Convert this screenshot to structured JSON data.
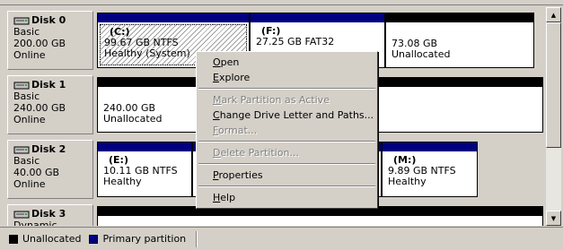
{
  "disks": [
    {
      "name": "Disk 0",
      "type": "Basic",
      "size": "200.00 GB",
      "status": "Online",
      "volumes": [
        {
          "letter": "(C:)",
          "size_fs": "99.67 GB NTFS",
          "status": "Healthy (System)",
          "kind": "primary",
          "selected": true
        },
        {
          "letter": "(F:)",
          "size_fs": "27.25 GB FAT32",
          "status": "",
          "kind": "primary",
          "selected": false
        },
        {
          "letter": "",
          "size_fs": "73.08 GB",
          "status": "Unallocated",
          "kind": "unallocated",
          "selected": false
        }
      ]
    },
    {
      "name": "Disk 1",
      "type": "Basic",
      "size": "240.00 GB",
      "status": "Online",
      "volumes": [
        {
          "letter": "",
          "size_fs": "240.00 GB",
          "status": "Unallocated",
          "kind": "unallocated",
          "selected": false
        }
      ]
    },
    {
      "name": "Disk 2",
      "type": "Basic",
      "size": "40.00 GB",
      "status": "Online",
      "volumes": [
        {
          "letter": "(E:)",
          "size_fs": "10.11 GB NTFS",
          "status": "Healthy",
          "kind": "primary",
          "selected": false
        },
        {
          "letter": "",
          "size_fs": "",
          "status": "",
          "kind": "primary",
          "selected": false
        },
        {
          "letter": "(M:)",
          "size_fs": "9.89 GB NTFS",
          "status": "Healthy",
          "kind": "primary",
          "selected": false
        }
      ]
    },
    {
      "name": "Disk 3",
      "type": "Dynamic",
      "size": "",
      "status": "",
      "volumes": [
        {
          "letter": "",
          "size_fs": "",
          "status": "",
          "kind": "unallocated",
          "selected": false
        }
      ]
    }
  ],
  "legend": [
    {
      "label": "Unallocated",
      "color": "#000000"
    },
    {
      "label": "Primary partition",
      "color": "#000080"
    }
  ],
  "context_menu": {
    "items": [
      {
        "label": "Open",
        "access": "O",
        "enabled": true
      },
      {
        "label": "Explore",
        "access": "E",
        "enabled": true
      },
      {
        "separator": true
      },
      {
        "label": "Mark Partition as Active",
        "access": "M",
        "enabled": false
      },
      {
        "label": "Change Drive Letter and Paths...",
        "access": "C",
        "enabled": true
      },
      {
        "label": "Format...",
        "access": "F",
        "enabled": false
      },
      {
        "separator": true
      },
      {
        "label": "Delete Partition...",
        "access": "D",
        "enabled": false
      },
      {
        "separator": true
      },
      {
        "label": "Properties",
        "access": "P",
        "enabled": true
      },
      {
        "separator": true
      },
      {
        "label": "Help",
        "access": "H",
        "enabled": true
      }
    ]
  },
  "colors": {
    "primary": "#000080",
    "unallocated": "#000000",
    "face": "#d4d0c8"
  }
}
